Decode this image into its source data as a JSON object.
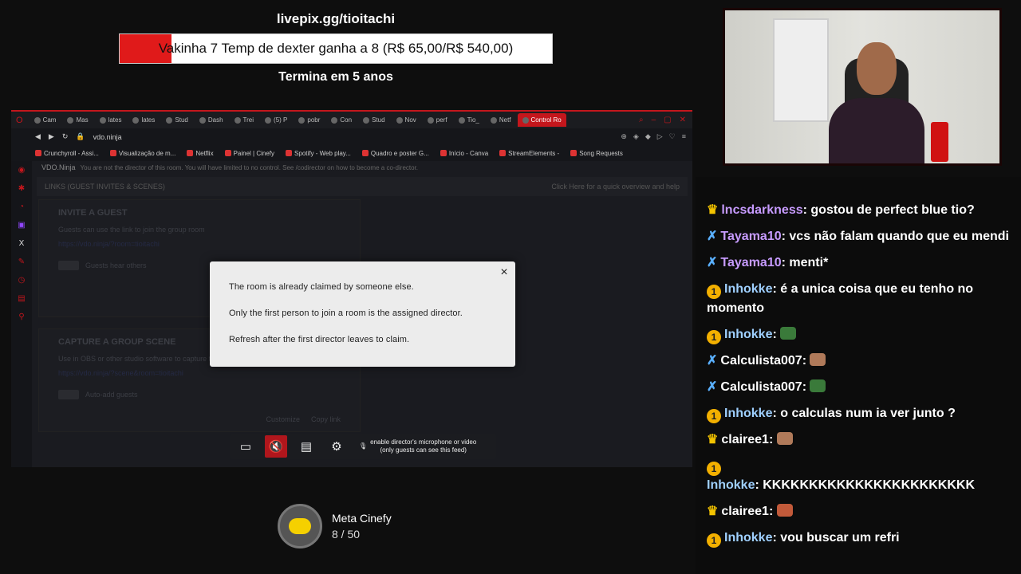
{
  "overlay": {
    "url": "livepix.gg/tioitachi",
    "goal_text": "Vakinha 7 Temp de dexter ganha a 8 (R$ 65,00/R$ 540,00)",
    "goal_progress": 0.12,
    "subtitle": "Termina em 5 anos"
  },
  "browser": {
    "tabs": [
      "Cam",
      "Mas",
      "lates",
      "lates",
      "Stud",
      "Dash",
      "Trei",
      "(5) P",
      "pobr",
      "Con",
      "Stud",
      "Nov",
      "perf",
      "Tio_",
      "Netf",
      "Control Ro"
    ],
    "active_tab": "Control Ro",
    "address": "vdo.ninja",
    "bookmarks": [
      "Crunchyroll - Assi...",
      "Visualização de m...",
      "Netflix",
      "Painel | Cinefy",
      "Spotify - Web play...",
      "Quadro e poster G...",
      "Início - Canva",
      "StreamElements -",
      "Song Requests"
    ],
    "page_header": "VDO.Ninja",
    "page_notice": "You are not the director of this room. You will have limited to no control. See /codirector on how to become a co-director.",
    "links_strip_label": "LINKS (GUEST INVITES & SCENES)",
    "help_link": "Click Here for a quick overview and help",
    "invite": {
      "title": "INVITE A GUEST",
      "description": "Guests can use the link to join the group room",
      "link": "https://vdo.ninja/?room=tioitachi",
      "toggle_label": "Guests hear others"
    },
    "capture": {
      "title": "CAPTURE A GROUP SCENE",
      "description": "Use in OBS or other studio software to capture the group video mix",
      "link": "https://vdo.ninja/?scene&room=tioitachi",
      "toggle_label": "Auto-add guests",
      "customize_label": "Customize",
      "copy_label": "Copy link"
    }
  },
  "dialog": {
    "line1": "The room is already claimed by someone else.",
    "line2": "Only the first person to join a room is the assigned director.",
    "line3": "Refresh after the first director leaves to claim."
  },
  "controls": {
    "enable_text_1": "enable director's microphone or video",
    "enable_text_2": "(only guests can see this feed)"
  },
  "meta": {
    "title": "Meta Cinefy",
    "count": "8 / 50"
  },
  "chat": [
    {
      "badge": "crown",
      "user": "lncsdarkness",
      "color": "purple",
      "text": "gostou de perfect blue tio?"
    },
    {
      "badge": "sword",
      "user": "Tayama10",
      "color": "purple",
      "text": "vcs não falam quando que eu mendi"
    },
    {
      "badge": "sword",
      "user": "Tayama10",
      "color": "purple",
      "text": "menti*"
    },
    {
      "badge": "one",
      "user": "Inhokke",
      "color": "blue",
      "text": "é a unica coisa que eu tenho no momento"
    },
    {
      "badge": "one",
      "user": "Inhokke",
      "color": "blue",
      "text": "",
      "emote": "#3a7a3a"
    },
    {
      "badge": "sword",
      "user": "Calculista007",
      "color": "white",
      "text": "",
      "emote": "#b07a5a"
    },
    {
      "badge": "sword",
      "user": "Calculista007",
      "color": "white",
      "text": "",
      "emote": "#3a7a3a"
    },
    {
      "badge": "one",
      "user": "Inhokke",
      "color": "blue",
      "text": "o calculas num ia ver junto ?"
    },
    {
      "badge": "crown",
      "user": "clairee1",
      "color": "white",
      "text": "",
      "emote": "#b07a5a"
    },
    {
      "badge": "one",
      "user": "Inhokke",
      "color": "blue",
      "text": "KKKKKKKKKKKKKKKKKKKKKKK",
      "split": true
    },
    {
      "badge": "crown",
      "user": "clairee1",
      "color": "white",
      "text": "",
      "emote": "#c25a3a"
    },
    {
      "badge": "one",
      "user": "Inhokke",
      "color": "blue",
      "text": "vou buscar um refri"
    }
  ]
}
